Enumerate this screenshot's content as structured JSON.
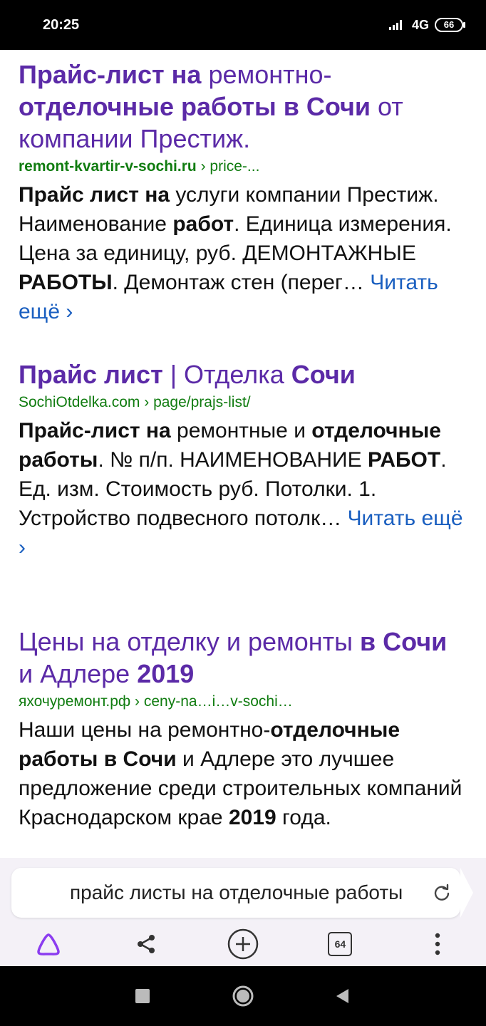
{
  "status_bar": {
    "time": "20:25",
    "network": "4G",
    "battery": "66"
  },
  "results": [
    {
      "title": [
        {
          "text": "Прайс-лист на",
          "bold": true
        },
        {
          "text": " ремонтно-",
          "bold": false
        },
        {
          "text": "отделочные работы в Сочи",
          "bold": true
        },
        {
          "text": " от компании Престиж.",
          "bold": false
        }
      ],
      "url": [
        {
          "text": "remont-kvartir-v-sochi.ru",
          "bold": true
        },
        {
          "text": " › price-...",
          "bold": false
        }
      ],
      "snippet": [
        {
          "text": "Прайс лист на",
          "bold": true
        },
        {
          "text": " услуги компании Престиж. Наименование ",
          "bold": false
        },
        {
          "text": "работ",
          "bold": true
        },
        {
          "text": ". Единица измерения. Цена за единицу, руб. ДЕМОНТАЖНЫЕ ",
          "bold": false
        },
        {
          "text": "РАБОТЫ",
          "bold": true
        },
        {
          "text": ". Демонтаж стен (перег… ",
          "bold": false
        }
      ],
      "more": "Читать ещё ›"
    },
    {
      "title": [
        {
          "text": "Прайс лист",
          "bold": true
        },
        {
          "text": " | Отделка ",
          "bold": false
        },
        {
          "text": "Сочи",
          "bold": true
        }
      ],
      "url": [
        {
          "text": "SochiOtdelka.com › page/prajs-list/",
          "bold": false
        }
      ],
      "snippet": [
        {
          "text": "Прайс-лист на",
          "bold": true
        },
        {
          "text": " ремонтные и ",
          "bold": false
        },
        {
          "text": "отделочные работы",
          "bold": true
        },
        {
          "text": ". № п/п. НАИМЕНОВАНИЕ ",
          "bold": false
        },
        {
          "text": "РАБОТ",
          "bold": true
        },
        {
          "text": ". Ед. изм. Стоимость руб. Потолки. 1. Устройство подвесного потолк… ",
          "bold": false
        }
      ],
      "more": "Читать ещё ›"
    },
    {
      "title": [
        {
          "text": "Цены на отделку и ремонты ",
          "bold": false
        },
        {
          "text": "в Сочи",
          "bold": true
        },
        {
          "text": " и Адлере ",
          "bold": false
        },
        {
          "text": "2019",
          "bold": true
        }
      ],
      "url": [
        {
          "text": "яхочуремонт.рф › ceny-na…i…v-sochi…",
          "bold": false
        }
      ],
      "snippet": [
        {
          "text": "Наши цены на ремонтно-",
          "bold": false
        },
        {
          "text": "отделочные работы в Сочи",
          "bold": true
        },
        {
          "text": " и Адлере это лучшее предложение среди строительных компаний Краснодарском крае ",
          "bold": false
        },
        {
          "text": "2019",
          "bold": true
        },
        {
          "text": " года.",
          "bold": false
        }
      ],
      "more": ""
    }
  ],
  "search_bar": {
    "query": "прайс листы на отделочные работы"
  },
  "toolbar": {
    "tabs_count": "64"
  },
  "colors": {
    "title": "#5b2aa7",
    "url": "#107c10",
    "link": "#1a5fc0",
    "alice": "#8b3cf0"
  }
}
